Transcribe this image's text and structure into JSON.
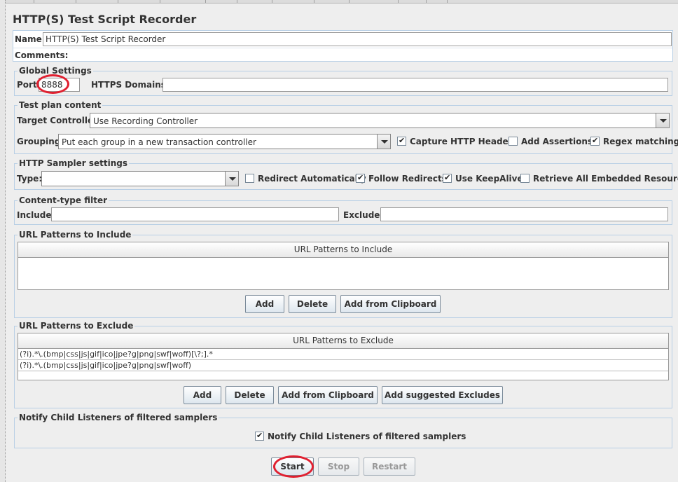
{
  "panel_title": "HTTP(S) Test Script Recorder",
  "name_row": {
    "label": "Name:",
    "value": "HTTP(S) Test Script Recorder"
  },
  "comments_row": {
    "label": "Comments:"
  },
  "global_settings": {
    "title": "Global Settings",
    "port_label": "Port:",
    "port_value": "8888",
    "https_domains_label": "HTTPS Domains :",
    "https_domains_value": ""
  },
  "test_plan_content": {
    "title": "Test plan content",
    "target_controller_label": "Target Controller:",
    "target_controller_value": "Use Recording Controller",
    "grouping_label": "Grouping:",
    "grouping_value": "Put each group in a new transaction controller",
    "capture_headers": {
      "label": "Capture HTTP Headers",
      "checked": true
    },
    "add_assertions": {
      "label": "Add Assertions",
      "checked": false
    },
    "regex_matching": {
      "label": "Regex matching",
      "checked": true
    }
  },
  "http_sampler": {
    "title": "HTTP Sampler settings",
    "type_label": "Type:",
    "type_value": "",
    "redirect_automatically": {
      "label": "Redirect Automatically",
      "checked": false
    },
    "follow_redirects": {
      "label": "Follow Redirects",
      "checked": true
    },
    "use_keepalive": {
      "label": "Use KeepAlive",
      "checked": true
    },
    "retrieve_embedded": {
      "label": "Retrieve All Embedded Resources",
      "checked": false
    }
  },
  "content_type_filter": {
    "title": "Content-type filter",
    "include_label": "Include:",
    "include_value": "",
    "exclude_label": "Exclude:",
    "exclude_value": ""
  },
  "url_include": {
    "title": "URL Patterns to Include",
    "column_header": "URL Patterns to Include",
    "rows": [],
    "add_label": "Add",
    "delete_label": "Delete",
    "clipboard_label": "Add from Clipboard"
  },
  "url_exclude": {
    "title": "URL Patterns to Exclude",
    "column_header": "URL Patterns to Exclude",
    "rows": [
      "(?i).*\\.(bmp|css|js|gif|ico|jpe?g|png|swf|woff)[\\?;].*",
      "(?i).*\\.(bmp|css|js|gif|ico|jpe?g|png|swf|woff)"
    ],
    "add_label": "Add",
    "delete_label": "Delete",
    "clipboard_label": "Add from Clipboard",
    "suggested_label": "Add suggested Excludes"
  },
  "notify": {
    "title": "Notify Child Listeners of filtered samplers",
    "checkbox": {
      "label": "Notify Child Listeners of filtered samplers",
      "checked": true
    }
  },
  "controls": {
    "start_label": "Start",
    "stop_label": "Stop",
    "restart_label": "Restart"
  },
  "colors": {
    "highlight_ring": "#e02030",
    "group_border": "#b8cfe5"
  }
}
